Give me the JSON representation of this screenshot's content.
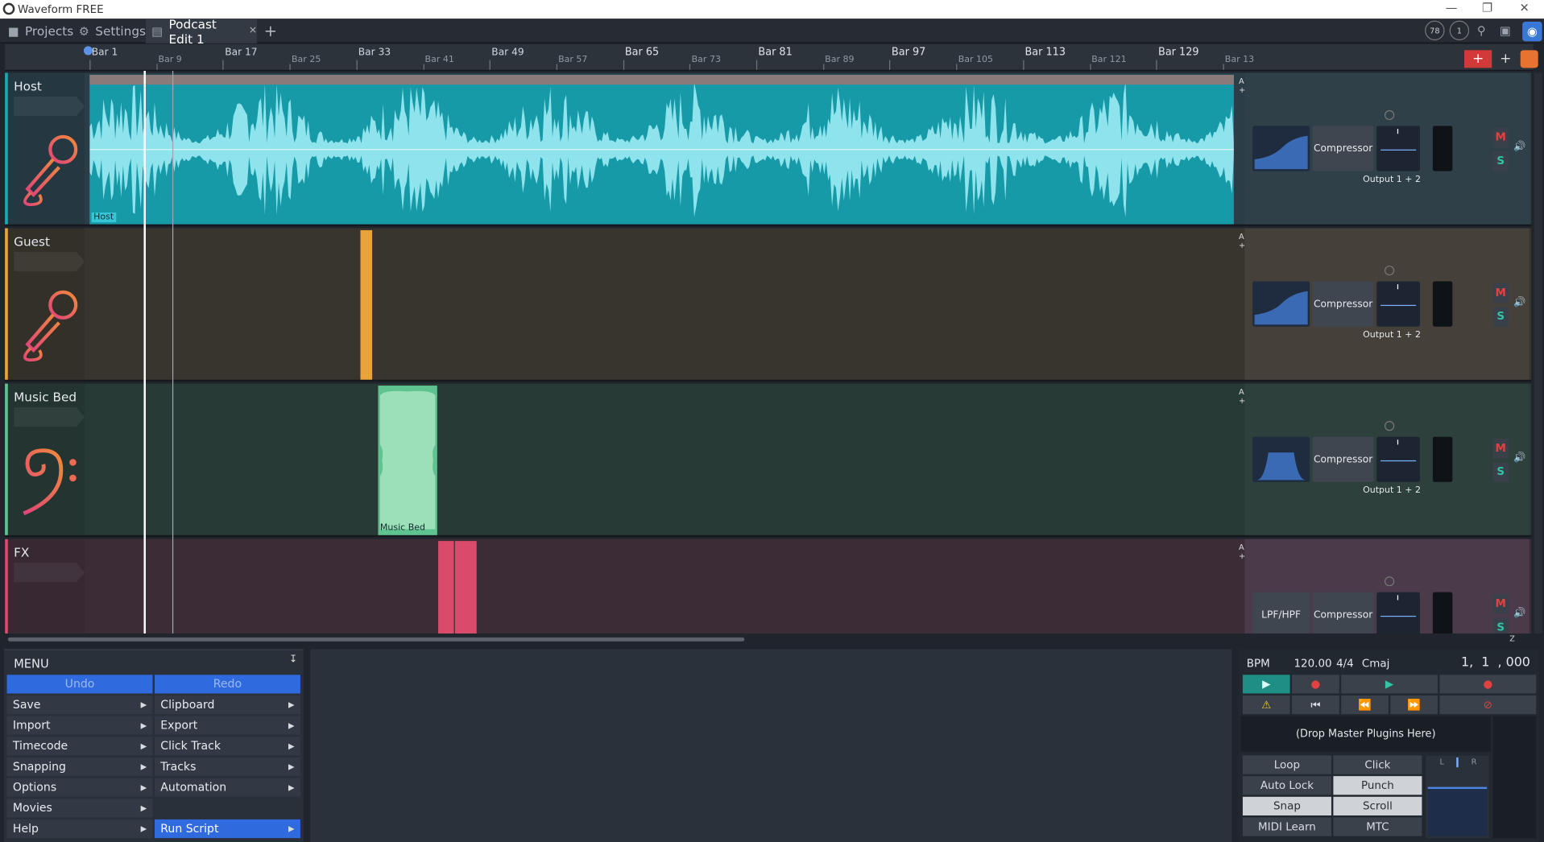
{
  "window": {
    "title": "Waveform FREE"
  },
  "tabs": [
    {
      "label": "Projects"
    },
    {
      "label": "Settings"
    },
    {
      "label": "Podcast Edit 1"
    }
  ],
  "top_right": {
    "cpu": "78",
    "count": "1"
  },
  "ruler": {
    "markers": [
      "Bar 1",
      "Bar 9",
      "Bar 17",
      "Bar 25",
      "Bar 33",
      "Bar 41",
      "Bar 49",
      "Bar 57",
      "Bar 65",
      "Bar 73",
      "Bar 81",
      "Bar 89",
      "Bar 97",
      "Bar 105",
      "Bar 113",
      "Bar 121",
      "Bar 129",
      "Bar 13"
    ]
  },
  "tracks": [
    {
      "name": "Host",
      "clip_label": "Host",
      "plugins": [
        "Compressor"
      ],
      "output": "Output 1 + 2",
      "color": "#1ea6b3"
    },
    {
      "name": "Guest",
      "plugins": [
        "Compressor"
      ],
      "output": "Output 1 + 2",
      "color": "#e8a33b"
    },
    {
      "name": "Music Bed",
      "clip_label": "Music Bed",
      "plugins": [
        "Compressor"
      ],
      "output": "Output 1 + 2",
      "color": "#5fc38f"
    },
    {
      "name": "FX",
      "plugins": [
        "LPF/HPF",
        "Compressor"
      ],
      "color": "#d94a6b"
    }
  ],
  "track_buttons": {
    "mute": "M",
    "solo": "S",
    "auto": "A",
    "plus": "+"
  },
  "menu": {
    "title": "MENU",
    "undo": "Undo",
    "redo": "Redo",
    "left": [
      "Save",
      "Import",
      "Timecode",
      "Snapping",
      "Options",
      "Movies",
      "Help"
    ],
    "right": [
      "Clipboard",
      "Export",
      "Click Track",
      "Tracks",
      "Automation",
      "",
      "Run Script"
    ]
  },
  "transport": {
    "bpm_label": "BPM",
    "bpm": "120.00",
    "time_sig": "4/4",
    "key": "Cmaj",
    "position": "1,  1  , 000",
    "drop_text": "(Drop Master Plugins Here)",
    "buttons": [
      "Loop",
      "Click",
      "Auto Lock",
      "Punch",
      "Snap",
      "Scroll",
      "MIDI Learn",
      "MTC"
    ],
    "meter_l": "L",
    "meter_r": "R"
  },
  "side_z": "Z"
}
